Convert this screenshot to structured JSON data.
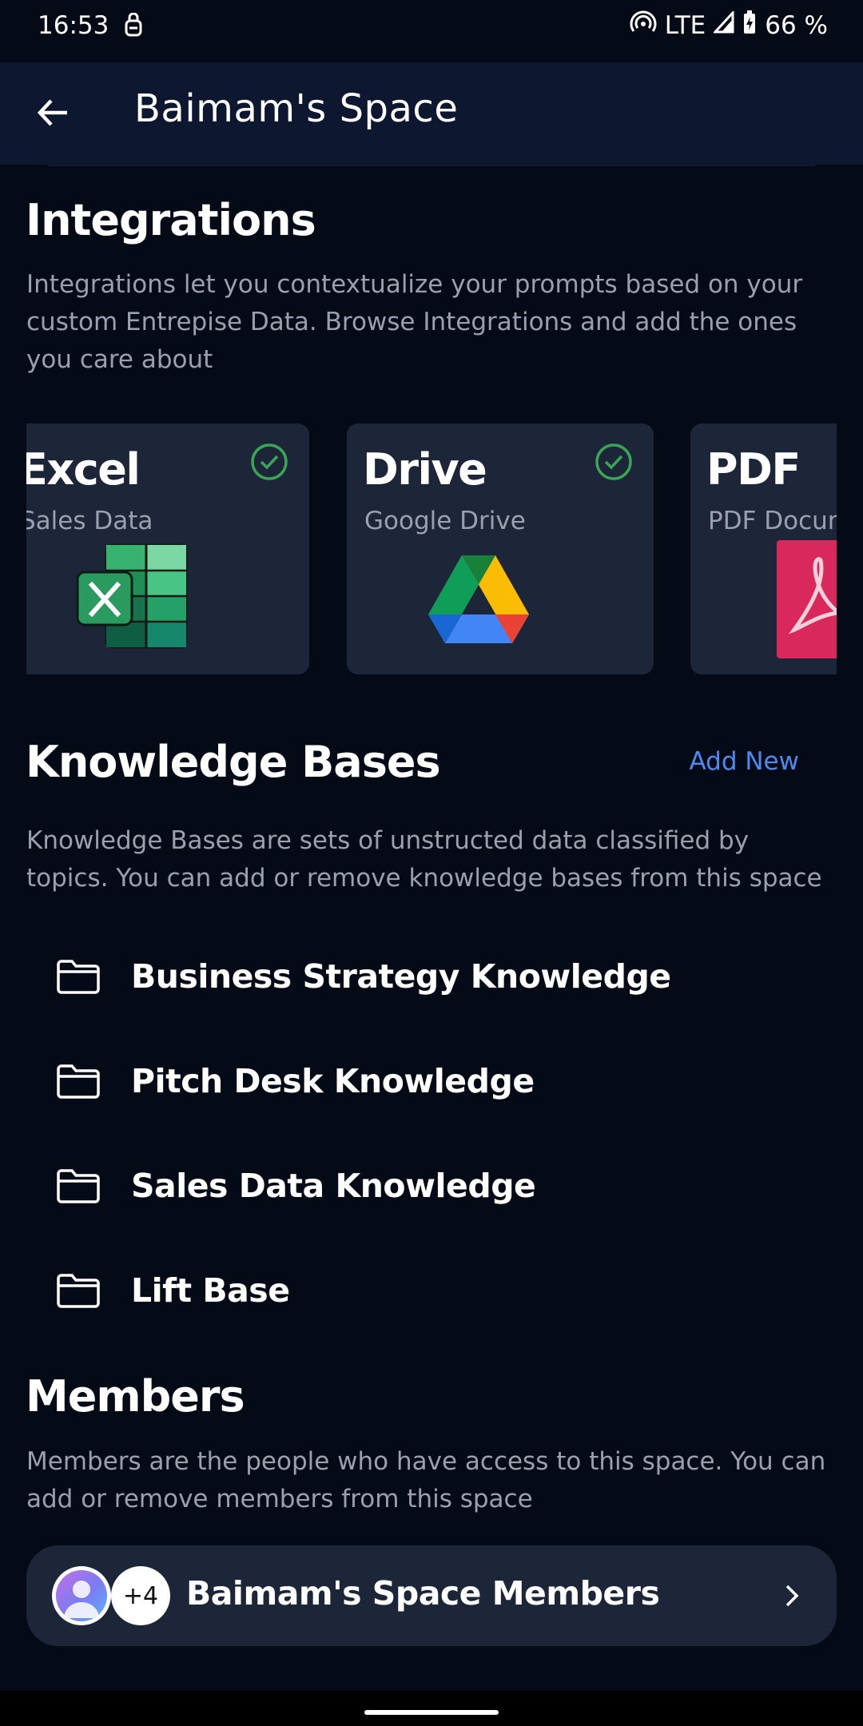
{
  "status_bar": {
    "time": "16:53",
    "network": "LTE",
    "battery": "66 %"
  },
  "app_bar": {
    "title": "Baimam's Space"
  },
  "integrations": {
    "heading": "Integrations",
    "description": "Integrations let you contextualize your prompts based on your custom Entrepise Data. Browse Integrations and add the ones you care about",
    "cards": [
      {
        "title": "Excel",
        "subtitle": "Sales Data",
        "icon": "excel-icon",
        "checked": true
      },
      {
        "title": "Drive",
        "subtitle": "Google Drive",
        "icon": "google-drive-icon",
        "checked": true
      },
      {
        "title": "PDF",
        "subtitle": "PDF Documents",
        "icon": "pdf-icon",
        "checked": false
      }
    ]
  },
  "knowledge_bases": {
    "heading": "Knowledge Bases",
    "add_new_label": "Add New",
    "description": "Knowledge Bases are sets of unstructed data classified by topics. You can add or remove knowledge bases from this space",
    "items": [
      {
        "label": "Business Strategy Knowledge",
        "icon": "folder-icon"
      },
      {
        "label": "Pitch Desk Knowledge",
        "icon": "folder-icon"
      },
      {
        "label": "Sales Data Knowledge",
        "icon": "folder-icon"
      },
      {
        "label": "Lift Base",
        "icon": "folder-icon"
      }
    ]
  },
  "members": {
    "heading": "Members",
    "description": "Members are the people who have access to this space. You can add or remove members from this space",
    "extra_count": "+4",
    "row_label": "Baimam's Space Members"
  },
  "colors": {
    "background": "#050a17",
    "app_bar": "#0d1730",
    "card": "#1d2638",
    "accent": "#4d8af0",
    "check": "#3aa655",
    "muted_text": "#9aa0ad"
  }
}
